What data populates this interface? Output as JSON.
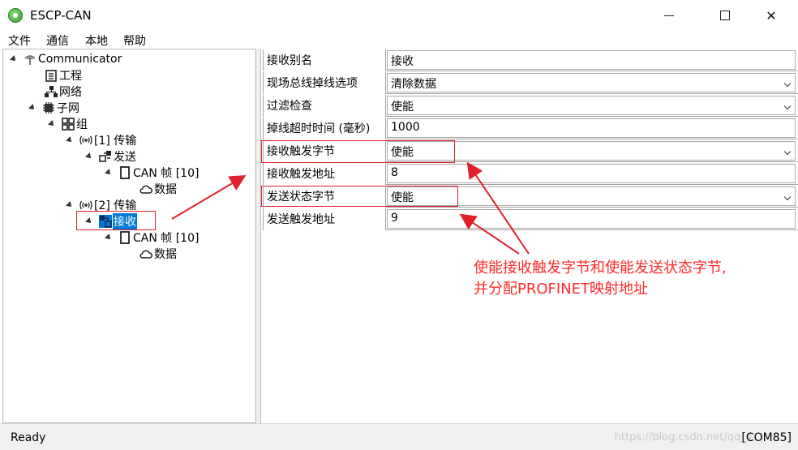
{
  "window": {
    "title": "ESCP-CAN"
  },
  "menu": [
    "文件",
    "通信",
    "本地",
    "帮助"
  ],
  "tree": [
    {
      "label": "Communicator",
      "icon": "antenna-icon",
      "expanded": true
    },
    {
      "label": "工程",
      "icon": "project-icon"
    },
    {
      "label": "网络",
      "icon": "network-icon"
    },
    {
      "label": "子网",
      "icon": "chip-icon",
      "expanded": true
    },
    {
      "label": "组",
      "icon": "group-grid-icon",
      "expanded": true
    },
    {
      "label": "[1] 传输",
      "icon": "wireless-icon",
      "expanded": true
    },
    {
      "label": "发送",
      "icon": "send-icon",
      "expanded": true
    },
    {
      "label": "CAN 帧 [10]",
      "icon": "frame-icon",
      "expanded": true
    },
    {
      "label": "数据",
      "icon": "cloud-icon"
    },
    {
      "label": "[2] 传输",
      "icon": "wireless-icon",
      "expanded": true
    },
    {
      "label": "接收",
      "icon": "receive-icon",
      "expanded": true,
      "selected": true
    },
    {
      "label": "CAN 帧 [10]",
      "icon": "frame-icon",
      "expanded": true
    },
    {
      "label": "数据",
      "icon": "cloud-icon"
    }
  ],
  "properties": [
    {
      "name": "接收别名",
      "value": "接收",
      "combo": false
    },
    {
      "name": "现场总线掉线选项",
      "value": "清除数据",
      "combo": true
    },
    {
      "name": "过滤检查",
      "value": "使能",
      "combo": true
    },
    {
      "name": "掉线超时时间 (毫秒)",
      "value": "1000",
      "combo": false
    },
    {
      "name": "接收触发字节",
      "value": "使能",
      "combo": true
    },
    {
      "name": "接收触发地址",
      "value": "8",
      "combo": false
    },
    {
      "name": "发送状态字节",
      "value": "使能",
      "combo": true
    },
    {
      "name": "发送触发地址",
      "value": "9",
      "combo": false
    }
  ],
  "annotation": {
    "line1": "使能接收触发字节和使能发送状态字节,",
    "line2": "并分配PROFINET映射地址"
  },
  "status": {
    "text": "Ready",
    "port": "[COM85]",
    "watermark": "https://blog.csdn.net/qq_4"
  },
  "colors": {
    "selection": "#0078d7",
    "annotation": "#e0202a"
  }
}
